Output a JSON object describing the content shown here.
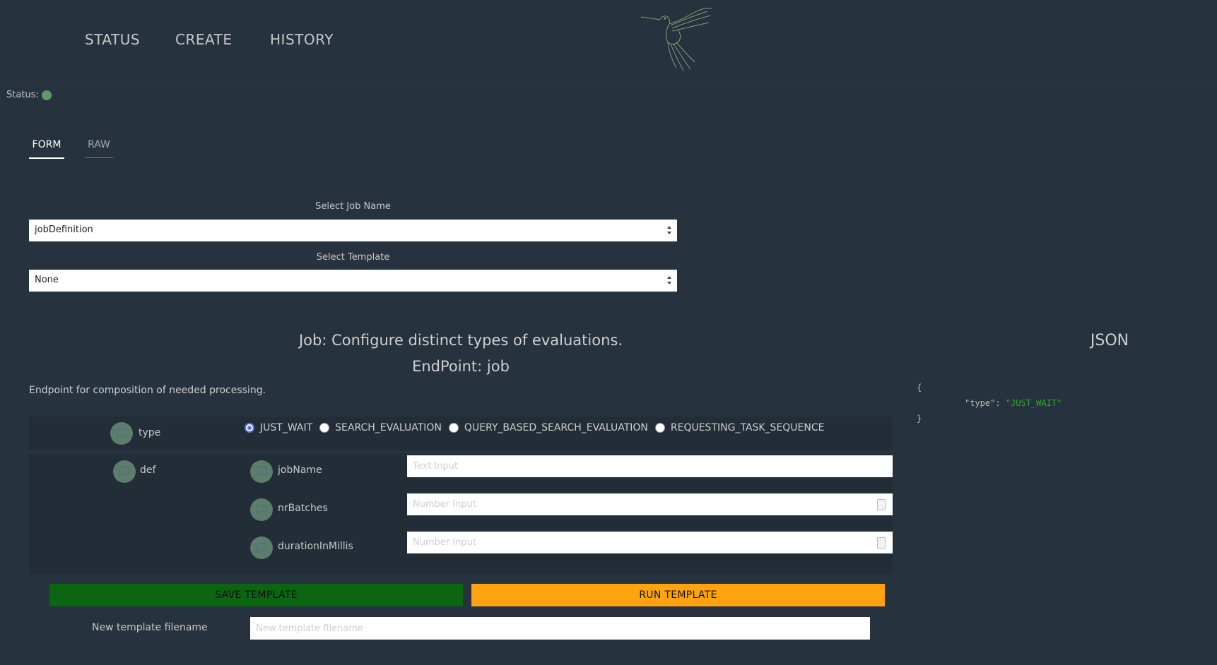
{
  "nav": {
    "items": [
      "STATUS",
      "CREATE",
      "HISTORY"
    ]
  },
  "status": {
    "label": "Status:",
    "color": "#5f9a6b"
  },
  "tabs": [
    {
      "label": "FORM",
      "active": true
    },
    {
      "label": "RAW",
      "active": false
    }
  ],
  "job_select": {
    "label": "Select Job Name",
    "value": "jobDefinition"
  },
  "template_select": {
    "label": "Select Template",
    "value": "None"
  },
  "job": {
    "title": "Job: Configure distinct types of evaluations.",
    "endpoint": "EndPoint: job",
    "description": "Endpoint for composition of needed processing."
  },
  "form": {
    "type_label": "type",
    "type_options": [
      "JUST_WAIT",
      "SEARCH_EVALUATION",
      "QUERY_BASED_SEARCH_EVALUATION",
      "REQUESTING_TASK_SEQUENCE"
    ],
    "type_selected": "JUST_WAIT",
    "def_label": "def",
    "fields": [
      {
        "label": "jobName",
        "placeholder": "Text Input"
      },
      {
        "label": "nrBatches",
        "placeholder": "Number Input"
      },
      {
        "label": "durationInMillis",
        "placeholder": "Number Input"
      }
    ]
  },
  "buttons": {
    "save": "SAVE TEMPLATE",
    "run": "RUN TEMPLATE",
    "save_color": "#0c6510",
    "run_color": "#ffa410"
  },
  "filename": {
    "label": "New template filename",
    "placeholder": "New template filename"
  },
  "json_panel": {
    "title": "JSON",
    "open": "{",
    "key": "\"type\"",
    "colon": ": ",
    "value": "\"JUST_WAIT\"",
    "close": "}"
  }
}
